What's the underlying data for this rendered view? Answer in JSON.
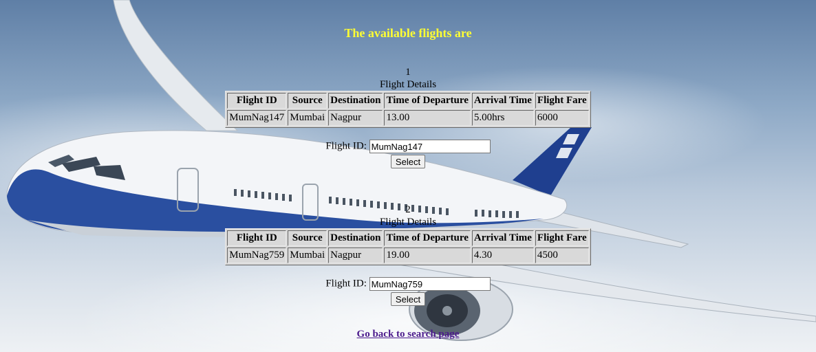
{
  "page": {
    "title": "The available flights are",
    "back_link": "Go back to search page"
  },
  "table_headers": [
    "Flight ID",
    "Source",
    "Destination",
    "Time of Departure",
    "Arrival Time",
    "Flight Fare"
  ],
  "flights": [
    {
      "number": "1",
      "caption": "Flight Details",
      "row": [
        "MumNag147",
        "Mumbai",
        "Nagpur",
        "13.00",
        "5.00hrs",
        "6000"
      ],
      "form": {
        "label": "Flight ID:",
        "value": "MumNag147",
        "button": "Select"
      }
    },
    {
      "number": "2",
      "caption": "Flight Details",
      "row": [
        "MumNag759",
        "Mumbai",
        "Nagpur",
        "19.00",
        "4.30",
        "4500"
      ],
      "form": {
        "label": "Flight ID:",
        "value": "MumNag759",
        "button": "Select"
      }
    }
  ],
  "colors": {
    "title": "#ffff33",
    "link": "#4b1a8c"
  }
}
